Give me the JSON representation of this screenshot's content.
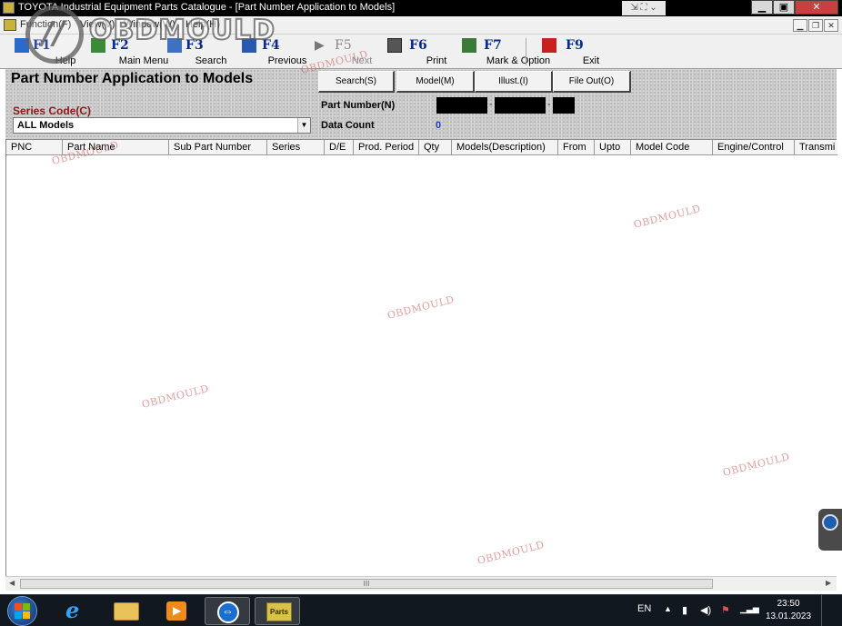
{
  "window": {
    "title": "TOYOTA Industrial Equipment Parts Catalogue - [Part Number Application to Models]",
    "extra_controls": "⇲ ⛶ ⌄"
  },
  "menu": {
    "items": [
      "Function(F)",
      "View(V)",
      "Window(W)",
      "Help(H)"
    ]
  },
  "toolbar": {
    "buttons": [
      {
        "key": "F1",
        "label": "Help",
        "enabled": true
      },
      {
        "key": "F2",
        "label": "Main Menu",
        "enabled": true
      },
      {
        "key": "F3",
        "label": "Search",
        "enabled": true
      },
      {
        "key": "F4",
        "label": "Previous",
        "enabled": true
      },
      {
        "key": "F5",
        "label": "Next",
        "enabled": false
      },
      {
        "key": "F6",
        "label": "Print",
        "enabled": true
      },
      {
        "key": "F7",
        "label": "Mark & Option",
        "enabled": true
      },
      {
        "key": "F9",
        "label": "Exit",
        "enabled": true
      }
    ]
  },
  "panel": {
    "title": "Part Number Application to Models",
    "buttons": [
      "Search(S)",
      "Model(M)",
      "Illust.(I)",
      "File Out(O)"
    ],
    "series_code_label": "Series Code(C)",
    "series_code_value": "ALL Models",
    "part_number_label": "Part Number(N)",
    "part_number_sep": "-",
    "data_count_label": "Data Count",
    "data_count_value": "0"
  },
  "grid": {
    "columns": [
      "PNC",
      "Part Name",
      "Sub Part Number",
      "Series",
      "D/E",
      "Prod. Period",
      "Qty",
      "Models(Description)",
      "From",
      "Upto",
      "Model Code",
      "Engine/Control",
      "Transmi"
    ],
    "rows": []
  },
  "scrollbar": {
    "grip": "III"
  },
  "watermark": {
    "logo_letter": "//",
    "logo_text": "OBDMOULD",
    "text": "OBDMOULD"
  },
  "taskbar": {
    "apps": [
      "internet-explorer",
      "file-explorer",
      "media-player",
      "teamviewer",
      "parts-catalogue"
    ],
    "active_label": "Parts",
    "language": "EN",
    "time": "23:50",
    "date": "13.01.2023"
  },
  "colors": {
    "accent": "#0a2a8c",
    "series_label": "#8a1a1a",
    "data_count": "#1a3cc8"
  }
}
